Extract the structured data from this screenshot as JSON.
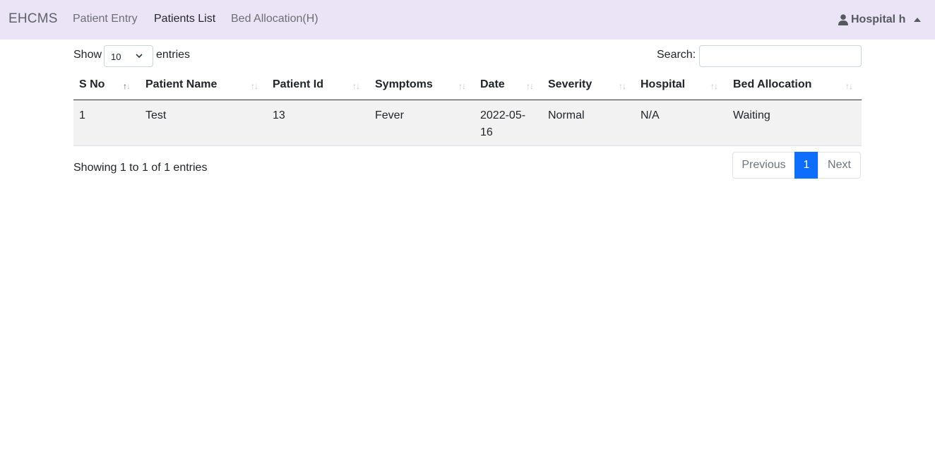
{
  "nav": {
    "brand": "EHCMS",
    "links": [
      "Patient Entry",
      "Patients List",
      "Bed Allocation(H)"
    ],
    "active_index": 1,
    "user": "Hospital h"
  },
  "length_control": {
    "show": "Show",
    "value": "10",
    "suffix": "entries"
  },
  "search": {
    "label": "Search:",
    "value": "",
    "placeholder": ""
  },
  "table": {
    "columns": [
      "S No",
      "Patient Name",
      "Patient Id",
      "Symptoms",
      "Date",
      "Severity",
      "Hospital",
      "Bed Allocation"
    ],
    "sorted_column_index": 0,
    "rows": [
      [
        "1",
        "Test",
        "13",
        "Fever",
        "2022-05-16",
        "Normal",
        "N/A",
        "Waiting"
      ]
    ],
    "date_display": [
      "2022-05-",
      "16"
    ]
  },
  "footer": {
    "info": "Showing 1 to 1 of 1 entries",
    "pagination": {
      "previous": "Previous",
      "current": "1",
      "next": "Next"
    }
  },
  "colors": {
    "navbar": "#ebe4f7",
    "accent": "#0d6efd",
    "stripe": "#f2f2f2"
  }
}
